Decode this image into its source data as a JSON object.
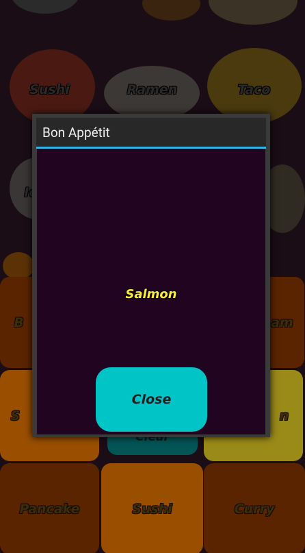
{
  "background": {
    "foods": [
      {
        "label": "Sushi"
      },
      {
        "label": "Ramen"
      },
      {
        "label": "Taco"
      },
      {
        "label": "Ic"
      }
    ],
    "tiles": [
      {
        "label": "B",
        "color": "#5a2400"
      },
      {
        "label": "",
        "color": "#5a2400"
      },
      {
        "label": "am",
        "color": "#5a2400"
      },
      {
        "label": "S",
        "color": "#9a4f00"
      },
      {
        "label": "n",
        "color": "#9a8a18"
      },
      {
        "label": "Pancake",
        "color": "#5a2400"
      },
      {
        "label": "Sushi",
        "color": "#9a4f00"
      },
      {
        "label": "Curry",
        "color": "#5a2400"
      }
    ],
    "clear_label": "Clear"
  },
  "dialog": {
    "title": "Bon Appétit",
    "result": "Salmon",
    "close_label": "Close",
    "accent_color": "#33b5e5",
    "button_color": "#00c4c5"
  }
}
